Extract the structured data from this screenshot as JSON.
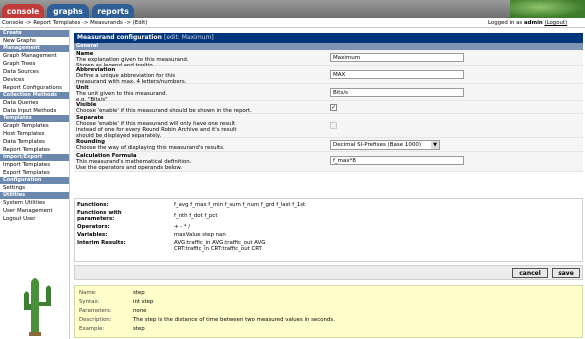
{
  "tabs": {
    "console": "console",
    "graphs": "graphs",
    "reports": "reports"
  },
  "breadcrumb": "Console -> Report Templates -> Measurands -> (Edit)",
  "user": {
    "prefix": "Logged in as",
    "name": "admin",
    "logout": "(Logout)"
  },
  "sidebar": [
    {
      "head": "Create"
    },
    {
      "item": "New Graphs"
    },
    {
      "head": "Management"
    },
    {
      "item": "Graph Management"
    },
    {
      "item": "Graph Trees"
    },
    {
      "item": "Data Sources"
    },
    {
      "item": "Devices"
    },
    {
      "item": "Report Configurations"
    },
    {
      "head": "Collection Methods"
    },
    {
      "item": "Data Queries"
    },
    {
      "item": "Data Input Methods"
    },
    {
      "head": "Templates"
    },
    {
      "item": "Graph Templates"
    },
    {
      "item": "Host Templates"
    },
    {
      "item": "Data Templates"
    },
    {
      "item": "Report Templates"
    },
    {
      "head": "Import/Export"
    },
    {
      "item": "Import Templates"
    },
    {
      "item": "Export Templates"
    },
    {
      "head": "Configuration"
    },
    {
      "item": "Settings"
    },
    {
      "head": "Utilities"
    },
    {
      "item": "System Utilities"
    },
    {
      "item": "User Management"
    },
    {
      "item": "Logout User"
    }
  ],
  "form": {
    "title": "Measurand configuration",
    "title_edit": "[edit: Maximum]",
    "group": "General",
    "name": {
      "label": "Name",
      "help1": "The explanation given to this measurand.",
      "help2": "Shown as legend and tooltip.",
      "value": "Maximum"
    },
    "abbr": {
      "label": "Abbreviation",
      "help1": "Define a unique abbreviation for this",
      "help2": "measurand with max. 4 letters/numbers.",
      "value": "MAX"
    },
    "unit": {
      "label": "Unit",
      "help1": "The unit given to this measurand.",
      "help2": "e.g. \"Bits/s\"",
      "value": "Bits/s"
    },
    "visible": {
      "label": "Visible",
      "help1": "Choose 'enable' if this measurand should be shown in the report.",
      "checked": true
    },
    "separate": {
      "label": "Separate",
      "help1": "Choose 'enable' if this measurand will only have one result",
      "help2": "instead of one for every Round Robin Archive and it's result",
      "help3": "should be displayed separately.",
      "checked": false
    },
    "rounding": {
      "label": "Rounding",
      "help1": "Choose the way of displaying this measurand's results.",
      "value": "Decimal SI-Prefixes (Base 1000)"
    },
    "formula": {
      "label": "Calculation Formula",
      "help1": "This measurand's mathematical definition.",
      "help2": "Use the operators and operands below.",
      "value": "f_max*8"
    }
  },
  "reference": {
    "functions": {
      "label": "Functions:",
      "value": "f_avg  f_max  f_min  f_sum  f_num  f_grd  f_last  f_1st"
    },
    "functions_params": {
      "label1": "Functions with",
      "label2": "parameters:",
      "value": "f_nth  f_dot  f_pct"
    },
    "operators": {
      "label": "Operators:",
      "value": "+   -   *   /"
    },
    "variables": {
      "label": "Variables:",
      "value": "maxValue  step  nan"
    },
    "interim": {
      "label": "Interim Results:",
      "line1": "AVG:traffic_in   AVG:traffic_out  AVG",
      "line2": "CRT:traffic_in   CRT:traffic_out  CRT"
    }
  },
  "buttons": {
    "cancel": "cancel",
    "save": "save"
  },
  "syntax": [
    {
      "label": "Name:",
      "value": "step"
    },
    {
      "label": "Syntax:",
      "value": "int step"
    },
    {
      "label": "Parameters:",
      "value": "none"
    },
    {
      "label": "Description:",
      "value": "The step is the distance of time between two measured values in seconds."
    },
    {
      "label": "Example:",
      "value": "step"
    }
  ]
}
